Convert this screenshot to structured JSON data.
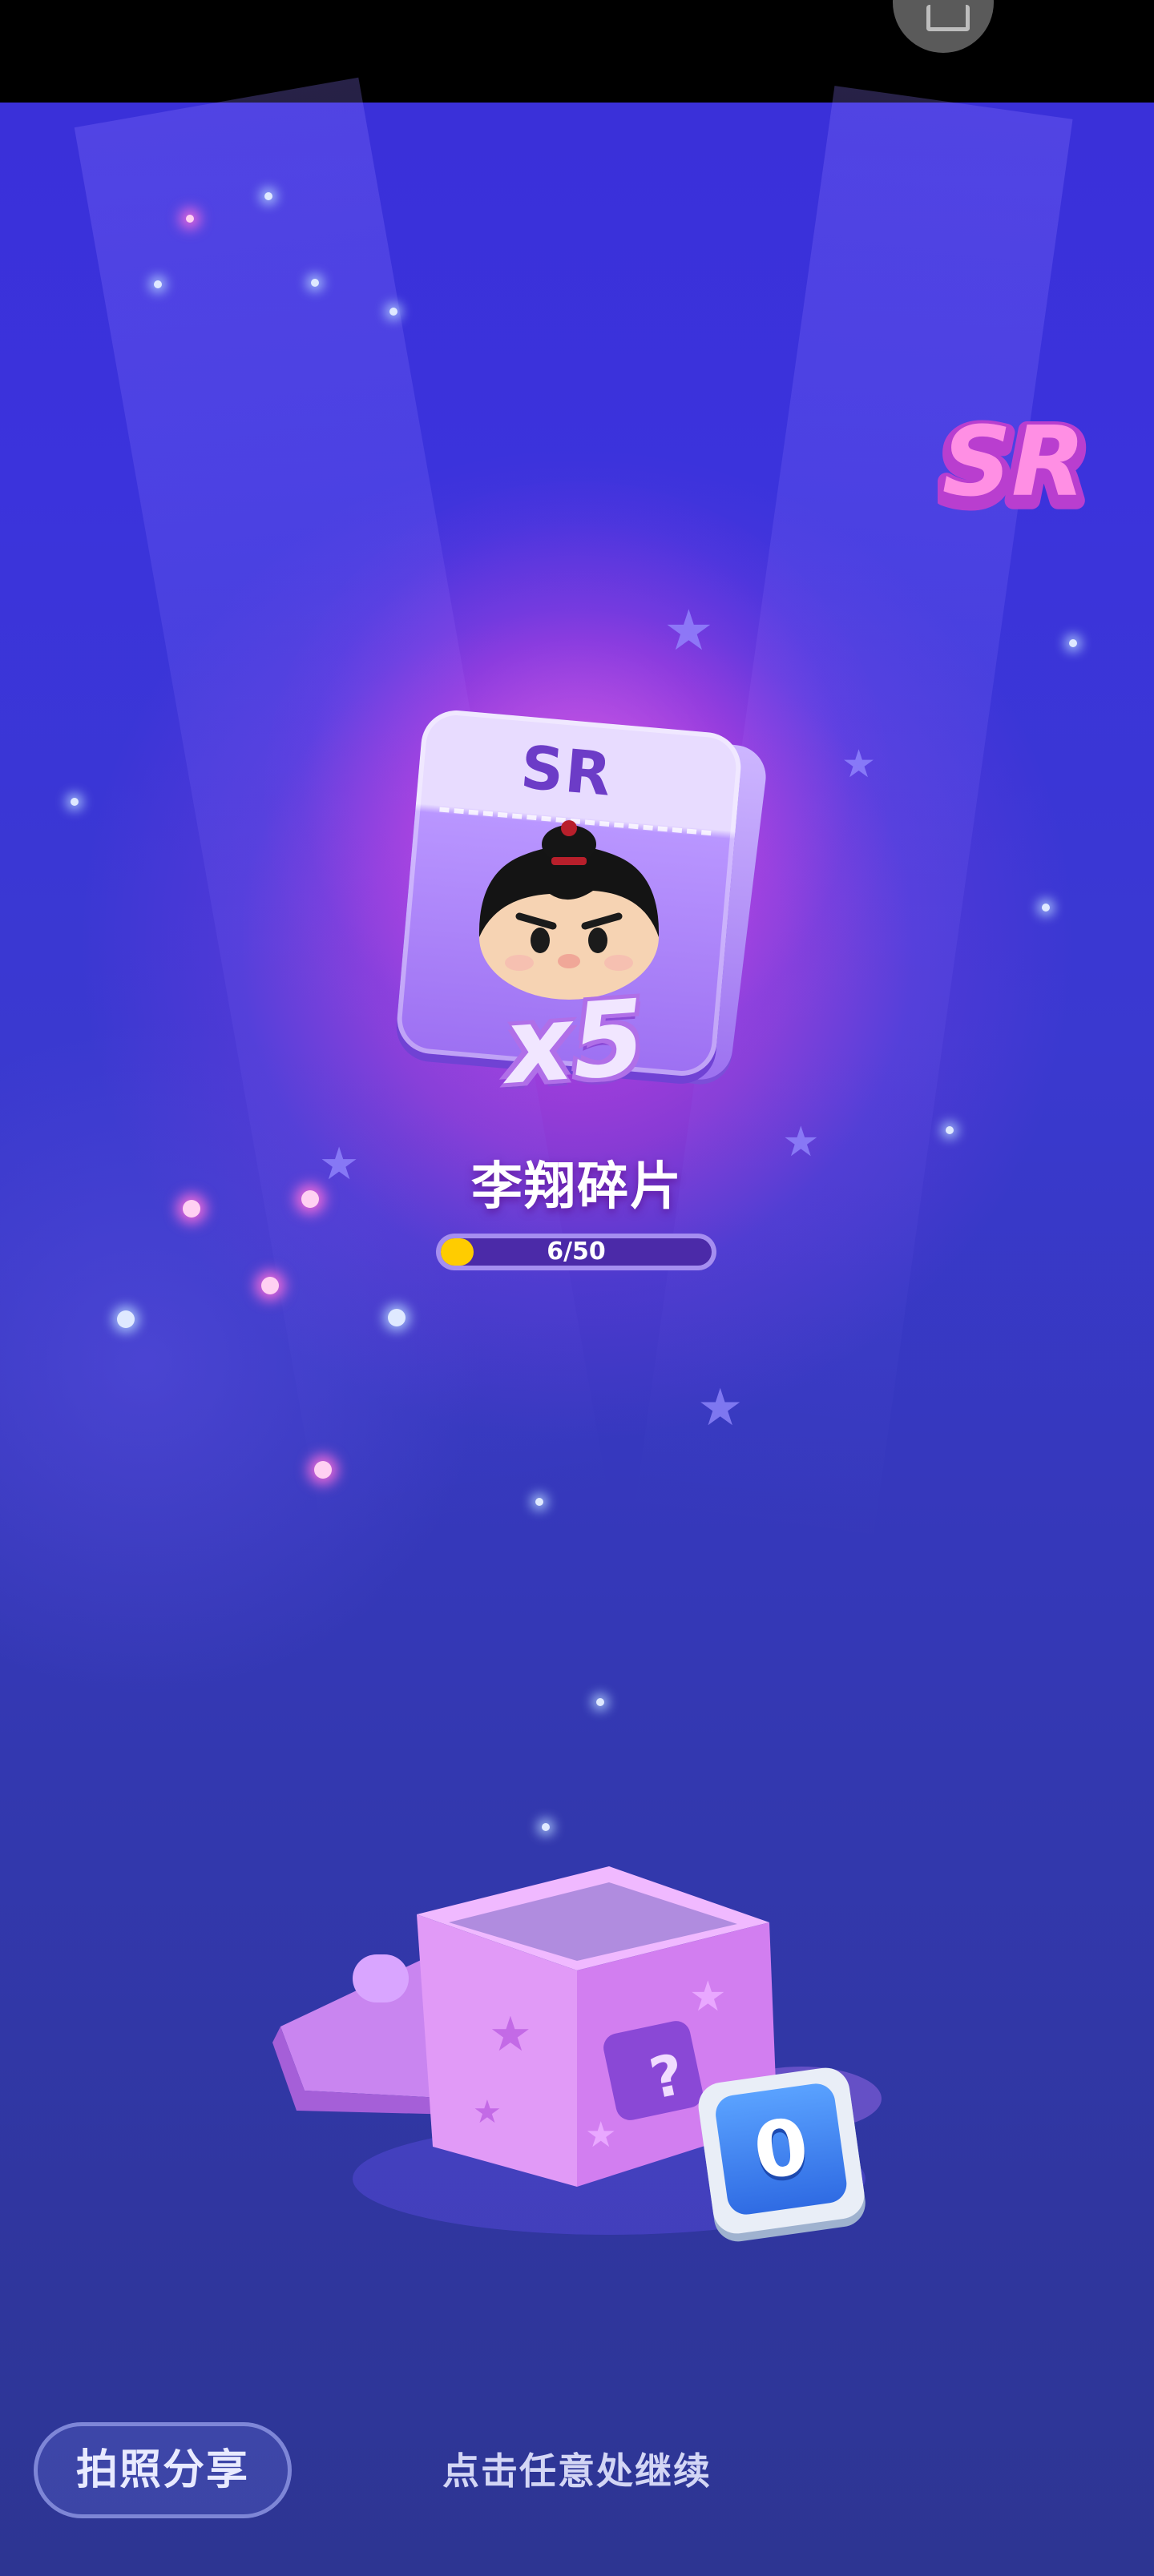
{
  "reward": {
    "rarity_badge": "SR",
    "card_rarity": "SR",
    "quantity": "x5",
    "item_name": "李翔碎片",
    "progress_text": "6/50",
    "progress_fraction": 0.12
  },
  "chest": {
    "counter": "0"
  },
  "footer": {
    "share_label": "拍照分享",
    "continue_hint": "点击任意处继续"
  },
  "colors": {
    "background_top": "#3a2fd8",
    "background_bottom": "#2d3592",
    "glow": "#f046e6",
    "card": "#9d70f2",
    "badge": "#ff7ad9",
    "progress_fill": "#ffcc00",
    "counter": "#2f6be3"
  },
  "icons": {
    "status": "screenshot-icon",
    "rarity": "sr-badge-icon",
    "avatar": "character-avatar-icon",
    "chest": "mystery-box-icon",
    "decoration": "star-icon"
  }
}
